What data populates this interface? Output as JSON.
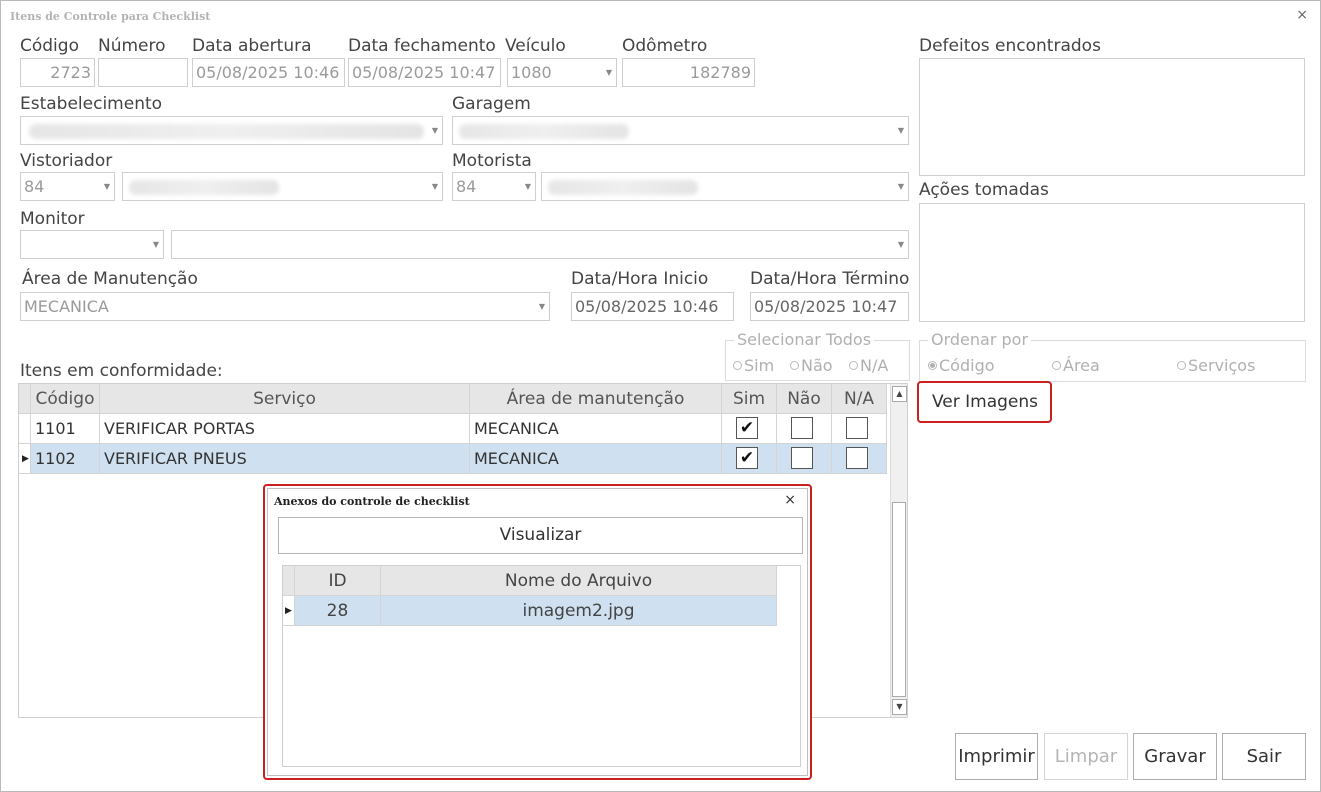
{
  "window": {
    "title": "Itens de Controle para Checklist",
    "close": "×"
  },
  "form": {
    "codigo": {
      "label": "Código",
      "value": "2723"
    },
    "numero": {
      "label": "Número",
      "value": ""
    },
    "data_abertura": {
      "label": "Data abertura",
      "value": "05/08/2025 10:46"
    },
    "data_fechamento": {
      "label": "Data fechamento",
      "value": "05/08/2025 10:47"
    },
    "veiculo": {
      "label": "Veículo",
      "value": "1080"
    },
    "odometro": {
      "label": "Odômetro",
      "value": "182789"
    },
    "estabelecimento": {
      "label": "Estabelecimento"
    },
    "garagem": {
      "label": "Garagem"
    },
    "vistoriador": {
      "label": "Vistoriador",
      "code": "84"
    },
    "motorista": {
      "label": "Motorista",
      "code": "84"
    },
    "monitor": {
      "label": "Monitor",
      "code": ""
    },
    "area_manutencao": {
      "label": "Área de Manutenção",
      "value": "MECANICA"
    },
    "data_hora_inicio": {
      "label": "Data/Hora Inicio",
      "value": "05/08/2025 10:46"
    },
    "data_hora_termino": {
      "label": "Data/Hora Término",
      "value": "05/08/2025 10:47"
    },
    "defeitos": {
      "label": "Defeitos encontrados"
    },
    "acoes": {
      "label": "Ações tomadas"
    }
  },
  "selecionar_todos": {
    "title": "Selecionar Todos",
    "options": [
      "Sim",
      "Não",
      "N/A"
    ]
  },
  "ordenar_por": {
    "title": "Ordenar por",
    "options": [
      "Código",
      "Área",
      "Serviços"
    ],
    "selected": "Código"
  },
  "ver_imagens": "Ver Imagens",
  "items_label": "Itens em conformidade:",
  "grid": {
    "headers": [
      "Código",
      "Serviço",
      "Área de manutenção",
      "Sim",
      "Não",
      "N/A"
    ],
    "rows": [
      {
        "codigo": "1101",
        "servico": "VERIFICAR PORTAS",
        "area": "MECANICA",
        "sim": true,
        "nao": false,
        "na": false
      },
      {
        "codigo": "1102",
        "servico": "VERIFICAR PNEUS",
        "area": "MECANICA",
        "sim": true,
        "nao": false,
        "na": false,
        "selected": true
      }
    ]
  },
  "buttons": {
    "imprimir": "Imprimir",
    "limpar": "Limpar",
    "gravar": "Gravar",
    "sair": "Sair"
  },
  "dialog": {
    "title": "Anexos do controle de checklist",
    "close": "×",
    "visualizar": "Visualizar",
    "headers": [
      "ID",
      "Nome do Arquivo"
    ],
    "rows": [
      {
        "id": "28",
        "nome": "imagem2.jpg"
      }
    ]
  },
  "colors": {
    "highlight": "#cc1f1f",
    "selected_row": "#cfe0f0"
  }
}
